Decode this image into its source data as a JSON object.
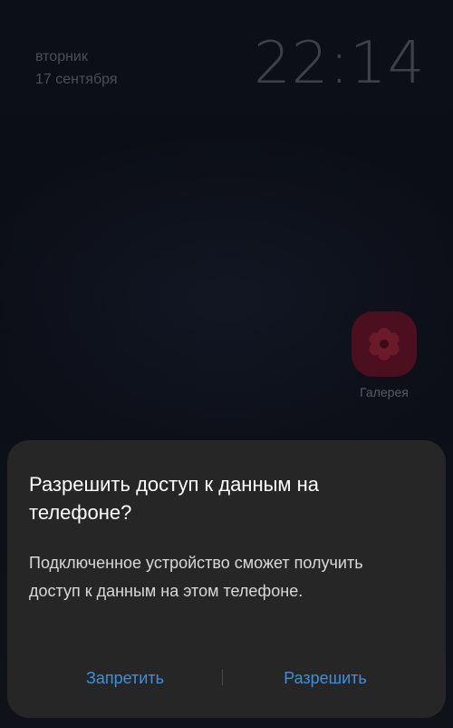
{
  "lockscreen": {
    "weekday": "вторник",
    "date": "17 сентября",
    "time": "22:14"
  },
  "apps": [
    {
      "label": "Галерея",
      "icon": "flower-icon",
      "color": "#4b0f1f"
    }
  ],
  "dialog": {
    "title": "Разрешить доступ к данным на телефоне?",
    "message": "Подключенное устройство сможет получить доступ к данным на этом телефоне.",
    "deny_label": "Запретить",
    "allow_label": "Разрешить",
    "button_color": "#3e8fe0"
  }
}
